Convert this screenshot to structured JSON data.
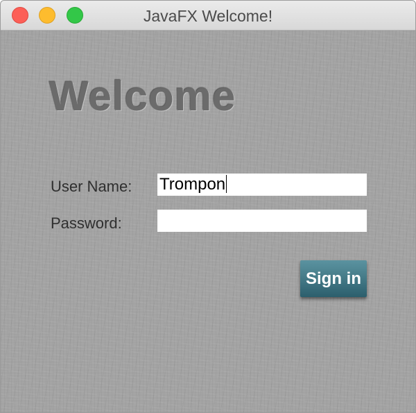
{
  "window": {
    "title": "JavaFX Welcome!"
  },
  "form": {
    "heading": "Welcome",
    "username_label": "User Name:",
    "username_value": "Trompon",
    "password_label": "Password:",
    "password_value": "",
    "signin_label": "Sign in"
  },
  "colors": {
    "signin_button": "#3d7482",
    "background": "#a3a3a3",
    "close": "#fc5f57",
    "minimize": "#fdbc2e",
    "maximize": "#33c748"
  }
}
